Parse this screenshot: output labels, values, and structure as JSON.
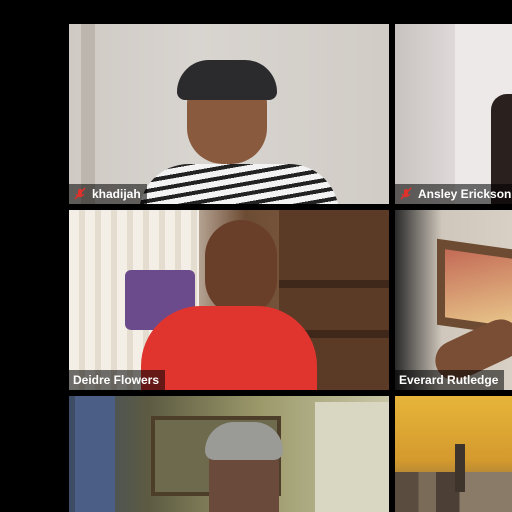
{
  "participants": [
    {
      "name": "khadijah",
      "muted": true
    },
    {
      "name": "Ansley Erickson",
      "muted": true
    },
    {
      "name": "Deidre Flowers",
      "muted": false
    },
    {
      "name": "Everard Rutledge",
      "muted": false
    },
    {
      "name": "",
      "muted": false
    },
    {
      "name": "",
      "muted": false
    }
  ],
  "icons": {
    "mute": "microphone-muted-icon"
  },
  "colors": {
    "background": "#000000",
    "mute": "#e0312b"
  }
}
